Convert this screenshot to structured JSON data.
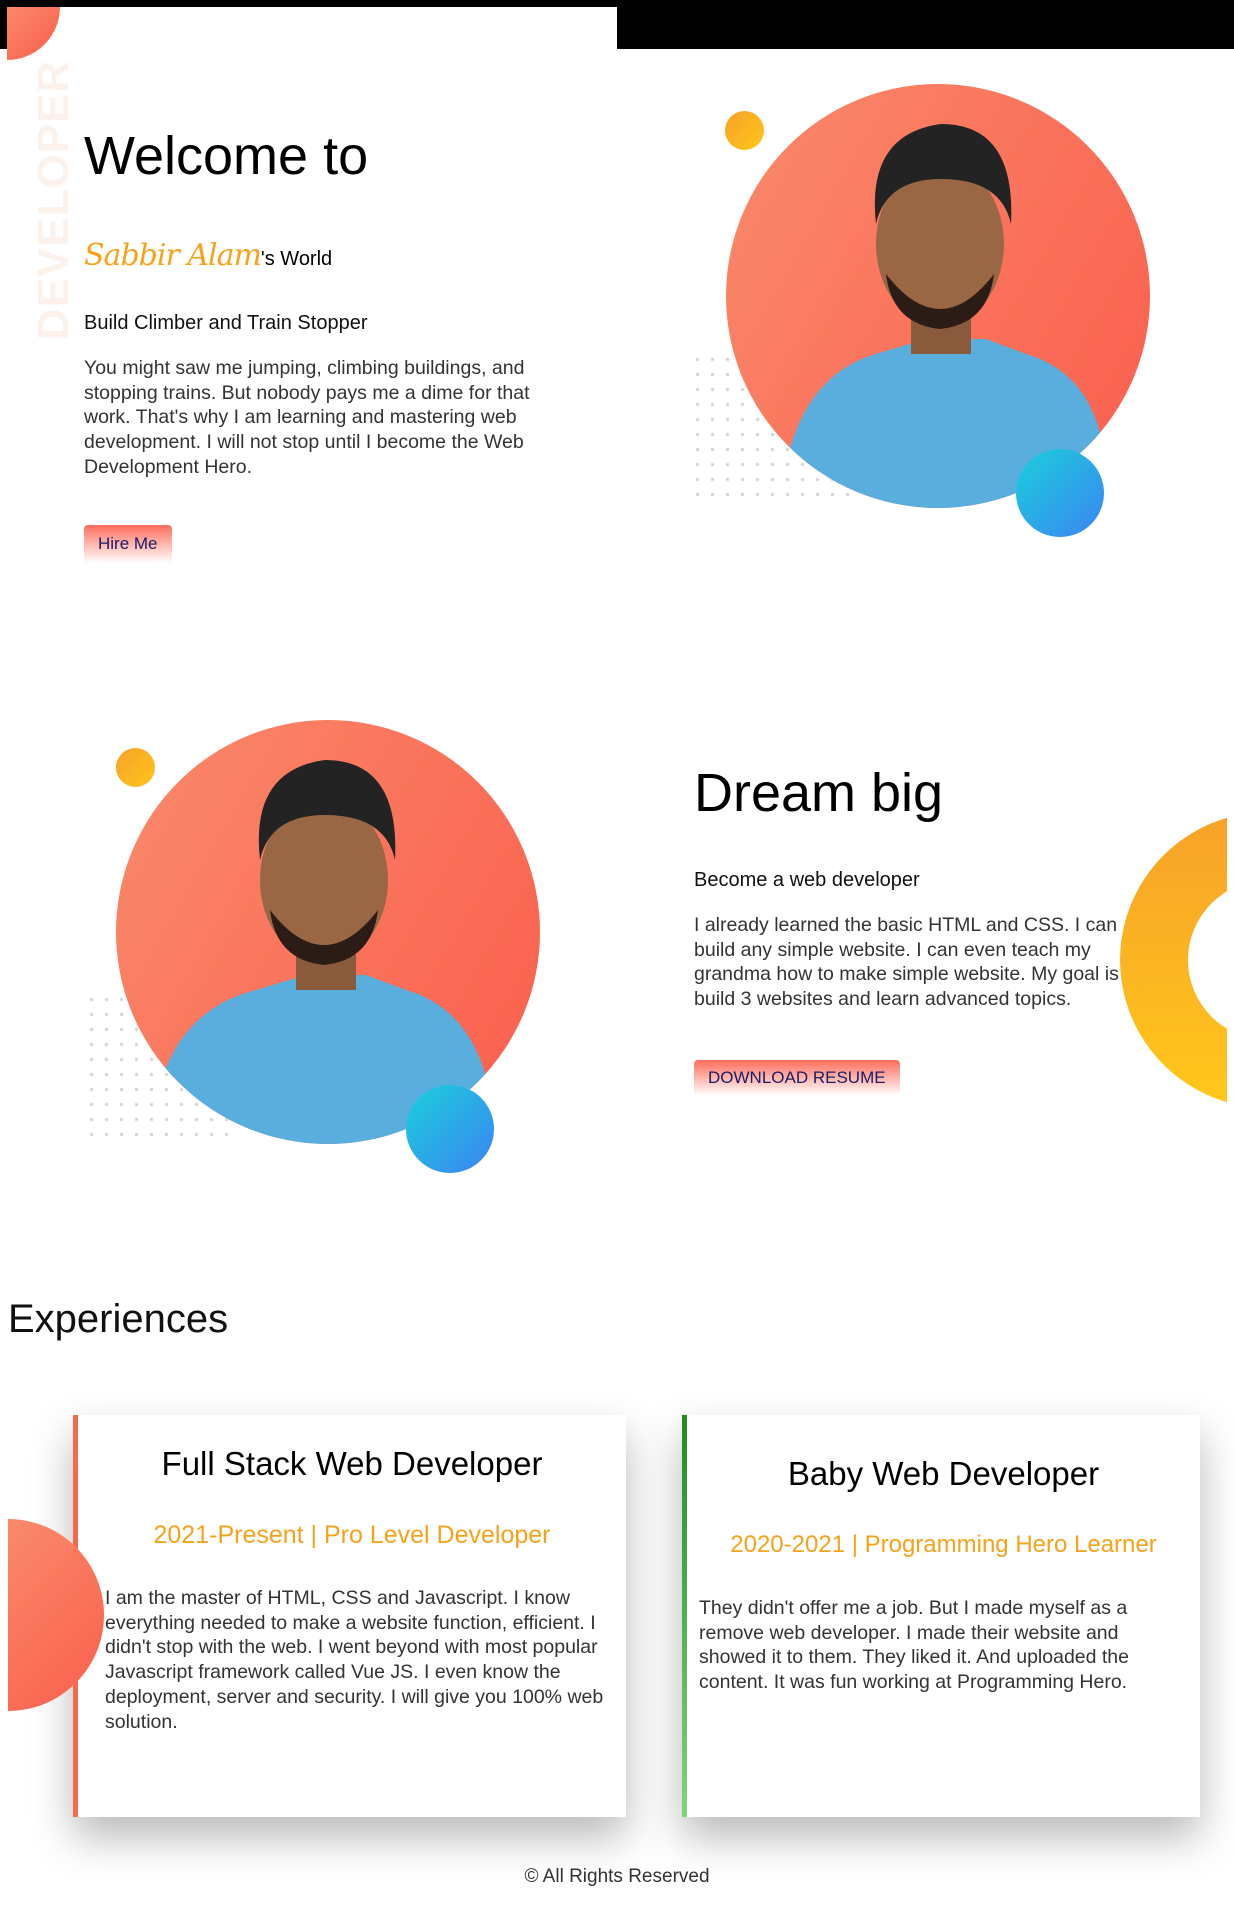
{
  "hero": {
    "side_word": "DEVELOPER",
    "title": "Welcome to",
    "name": "Sabbir Alam",
    "name_suffix": "'s World",
    "subtitle": "Build Climber and Train Stopper",
    "description": "You might saw me jumping, climbing buildings, and stopping trains. But nobody pays me a dime for that work. That's why I am learning and mastering web development. I will not stop until I become the Web Development Hero.",
    "button_label": "Hire Me"
  },
  "about": {
    "title": "Dream big",
    "subtitle": "Become a web developer",
    "description": "I already learned the basic HTML and CSS. I can build any simple website. I can even teach my grandma how to make simple website. My goal is to build 3 websites and learn advanced topics.",
    "button_label": "DOWNLOAD RESUME"
  },
  "experiences": {
    "heading": "Experiences",
    "items": [
      {
        "title": "Full Stack Web Developer",
        "period": "2021-Present | Pro Level Developer",
        "description": "I am the master of HTML, CSS and Javascript. I know everything needed to make a website function, efficient. I didn't stop with the web. I went beyond with most popular Javascript framework called Vue JS. I even know the deployment, server and security. I will give you 100% web solution.",
        "accent": "#f26b4f"
      },
      {
        "title": "Baby Web Developer",
        "period": "2020-2021 | Programming Hero Learner",
        "description": "They didn't offer me a job. But I made myself as a remove web developer. I made their website and showed it to them. They liked it. And uploaded the content. It was fun working at Programming Hero.",
        "accent": "#1e8c1e"
      }
    ]
  },
  "footer": {
    "text": "© All Rights Reserved"
  },
  "colors": {
    "primary": "#fb6d5b",
    "accent_yellow": "#f5a31a",
    "accent_blue": "#3b84f3",
    "button_text": "#1d1a66"
  }
}
